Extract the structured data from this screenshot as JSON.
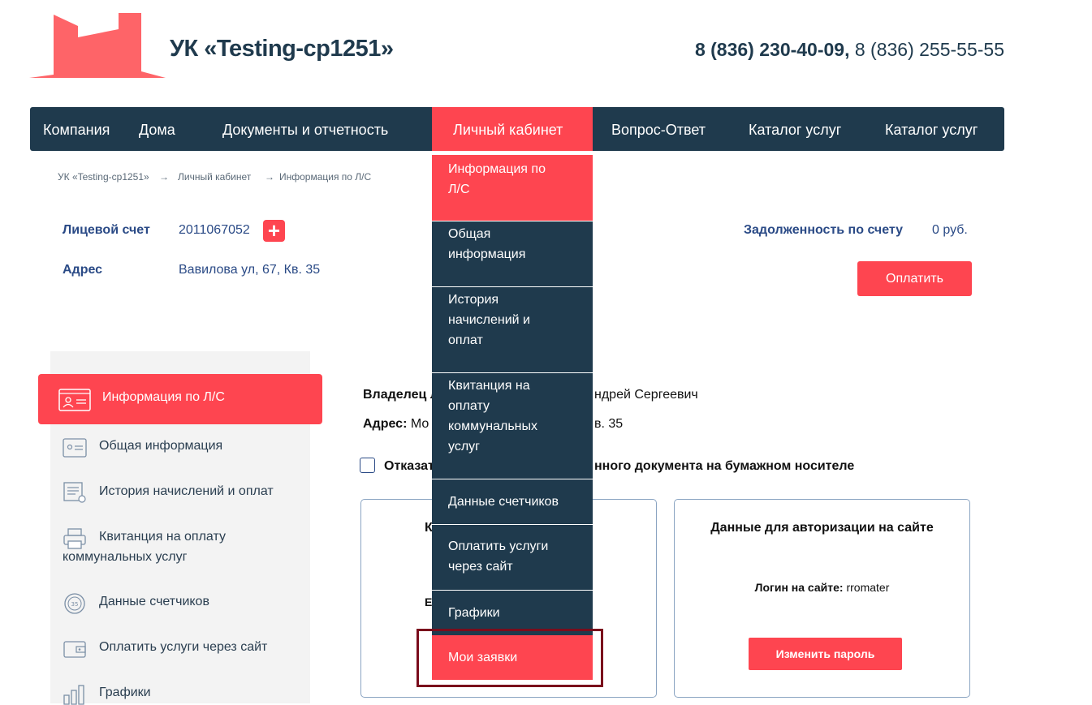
{
  "header": {
    "brand": "УК «Testing-cp1251»",
    "phone_main": "8 (836) 230-40-09,",
    "phone_alt": " 8 (836) 255-55-55"
  },
  "nav": {
    "items": [
      "Компания",
      "Дома",
      "Документы и отчетность",
      "Личный кабинет",
      "Вопрос-Ответ",
      "Каталог услуг",
      "Каталог услуг"
    ],
    "active": "Личный кабинет"
  },
  "breadcrumb": [
    "УК «Testing-cp1251»",
    "→",
    "Личный кабинет",
    "→",
    "Информация по Л/С"
  ],
  "account": {
    "number_label": "Лицевой счет",
    "number_value": "2011067052",
    "add_symbol": "+",
    "address_label": "Адрес",
    "address_value": "Вавилова ул, 67, Кв. 35",
    "debt_label": "Задолженность по счету",
    "debt_value": "0 руб.",
    "pay_button": "Оплатить"
  },
  "sidebar": {
    "items": [
      {
        "label": "Информация по Л/С",
        "icon": "id-card-icon",
        "active": true
      },
      {
        "label": "Общая информация",
        "icon": "id-card-icon"
      },
      {
        "label": "История начислений и оплат",
        "icon": "receipt-icon"
      },
      {
        "label": "Квитанция на оплату",
        "label2": "коммунальных услуг",
        "icon": "printer-icon"
      },
      {
        "label": "Данные счетчиков",
        "icon": "meter-icon"
      },
      {
        "label": "Оплатить услуги через сайт",
        "icon": "wallet-icon"
      },
      {
        "label": "Графики",
        "icon": "bar-chart-icon"
      }
    ]
  },
  "main": {
    "owner_label": "Владелец л",
    "owner_value": "ндрей Сергеевич",
    "address_label": "Адрес:",
    "address_value_start": " Мо",
    "address_value_end": "в. 35",
    "paper_checkbox_start": "Отказат",
    "paper_checkbox_end": "нного документа на бумажном носителе",
    "card1_fragment_a": "К",
    "card1_fragment_b": "E",
    "card2_title": "Данные для авторизации на сайте",
    "login_label": "Логин на сайте:",
    "login_value": " rromater",
    "change_password": "Изменить пароль"
  },
  "dropdown": {
    "items": [
      {
        "lines": [
          "Информация по",
          "Л/С"
        ],
        "active": true
      },
      {
        "lines": [
          "Общая",
          "информация"
        ]
      },
      {
        "lines": [
          "История",
          "начислений и",
          "оплат"
        ]
      },
      {
        "lines": [
          "Квитанция на",
          "оплату",
          "коммунальных",
          "услуг"
        ]
      },
      {
        "lines": [
          "Данные счетчиков"
        ]
      },
      {
        "lines": [
          "Оплатить услуги",
          "через сайт"
        ]
      },
      {
        "lines": [
          "Графики"
        ]
      },
      {
        "lines": [
          "Мои заявки"
        ],
        "highlighted": true
      }
    ]
  },
  "colors": {
    "accent": "#fe4550",
    "navy": "#1f3a4d",
    "link_blue": "#2a4a86",
    "highlight_border": "#7a0c1c"
  }
}
